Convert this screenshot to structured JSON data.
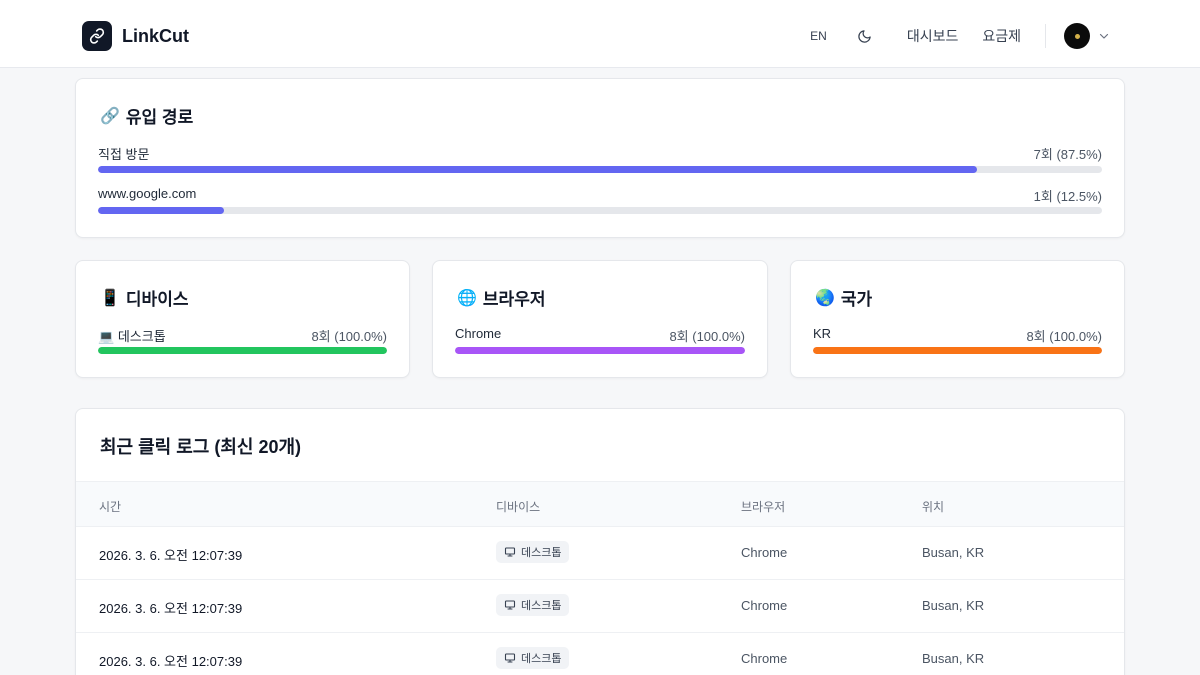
{
  "header": {
    "app_name": "LinkCut",
    "lang_label": "EN",
    "nav_dashboard": "대시보드",
    "nav_pricing": "요금제"
  },
  "referrers": {
    "icon": "🔗",
    "title": "유입 경로",
    "bar_color": "#6366f1",
    "items": [
      {
        "label": "직접 방문",
        "value": "7회 (87.5%)",
        "percent": 87.5
      },
      {
        "label": "www.google.com",
        "value": "1회 (12.5%)",
        "percent": 12.5
      }
    ]
  },
  "devices": {
    "icon": "📱",
    "title": "디바이스",
    "bar_color": "#22c55e",
    "items": [
      {
        "icon": "💻",
        "label": "데스크톱",
        "value": "8회 (100.0%)",
        "percent": 100
      }
    ]
  },
  "browsers": {
    "icon": "🌐",
    "title": "브라우저",
    "bar_color": "#a855f7",
    "items": [
      {
        "label": "Chrome",
        "value": "8회 (100.0%)",
        "percent": 100
      }
    ]
  },
  "countries": {
    "icon": "🌏",
    "title": "국가",
    "bar_color": "#f97316",
    "items": [
      {
        "label": "KR",
        "value": "8회 (100.0%)",
        "percent": 100
      }
    ]
  },
  "click_log": {
    "title": "최근 클릭 로그 (최신 20개)",
    "columns": [
      "시간",
      "디바이스",
      "브라우저",
      "위치"
    ],
    "rows": [
      {
        "time": "2026. 3. 6. 오전 12:07:39",
        "device": "데스크톱",
        "browser": "Chrome",
        "location": "Busan, KR"
      },
      {
        "time": "2026. 3. 6. 오전 12:07:39",
        "device": "데스크톱",
        "browser": "Chrome",
        "location": "Busan, KR"
      },
      {
        "time": "2026. 3. 6. 오전 12:07:39",
        "device": "데스크톱",
        "browser": "Chrome",
        "location": "Busan, KR"
      }
    ]
  }
}
